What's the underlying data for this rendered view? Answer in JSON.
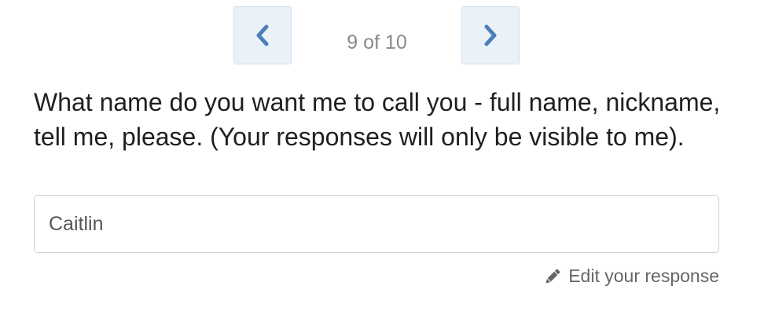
{
  "pager": {
    "counter": "9 of 10",
    "prev_icon": "chevron-left-icon",
    "next_icon": "chevron-right-icon",
    "accent": "#4a7fb8"
  },
  "question": {
    "text": "What name do you want me to call you - full name, nickname, tell me, please. (Your responses will only be visible to me)."
  },
  "response": {
    "value": "Caitlin"
  },
  "edit": {
    "icon": "pencil-icon",
    "label": "Edit your response"
  }
}
